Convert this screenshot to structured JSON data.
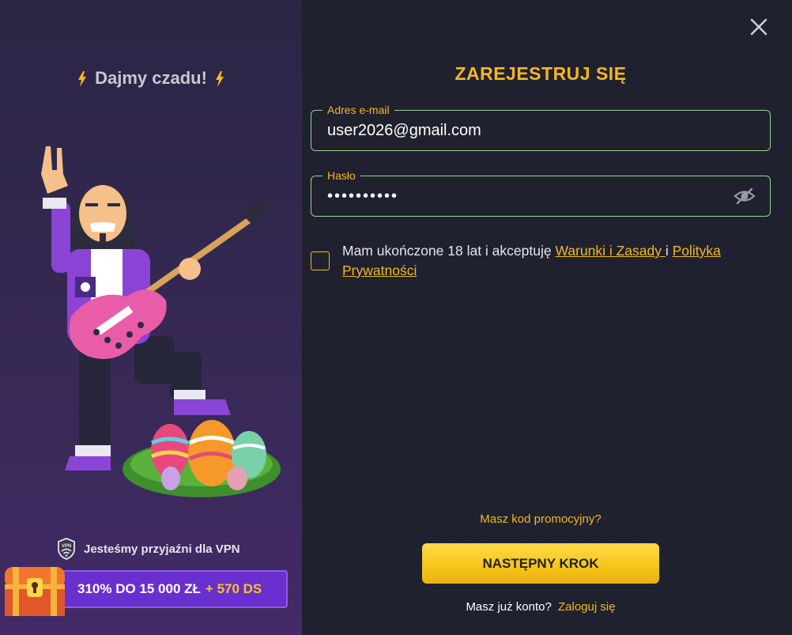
{
  "promo": {
    "title": "Dajmy czadu!",
    "vpn_text": "Jesteśmy przyjaźni dla VPN",
    "bonus": {
      "main": "310% DO 15 000 ZŁ",
      "extra": "+ 570 DS"
    }
  },
  "form": {
    "title": "ZAREJESTRUJ SIĘ",
    "email": {
      "label": "Adres e-mail",
      "value": "user2026@gmail.com"
    },
    "password": {
      "label": "Hasło",
      "value": "••••••••••"
    },
    "terms": {
      "prefix": "Mam ukończone 18 lat i akceptuję ",
      "link1": "Warunki i Zasady ",
      "middle": "i ",
      "link2": "Polityka Prywatności"
    },
    "promo_code_link": "Masz kod promocyjny?",
    "next_button": "NASTĘPNY KROK",
    "login_prompt": "Masz już konto?",
    "login_link": "Zaloguj się"
  },
  "colors": {
    "accent": "#f3b81e",
    "field_border": "#8ed98c",
    "background": "#20212f",
    "bonus_bg": "#6a2fcf"
  },
  "icons": {
    "close": "close-icon",
    "eye": "eye-off-icon",
    "vpn": "vpn-shield-icon",
    "bolt": "lightning-icon",
    "chest": "treasure-chest-icon"
  }
}
